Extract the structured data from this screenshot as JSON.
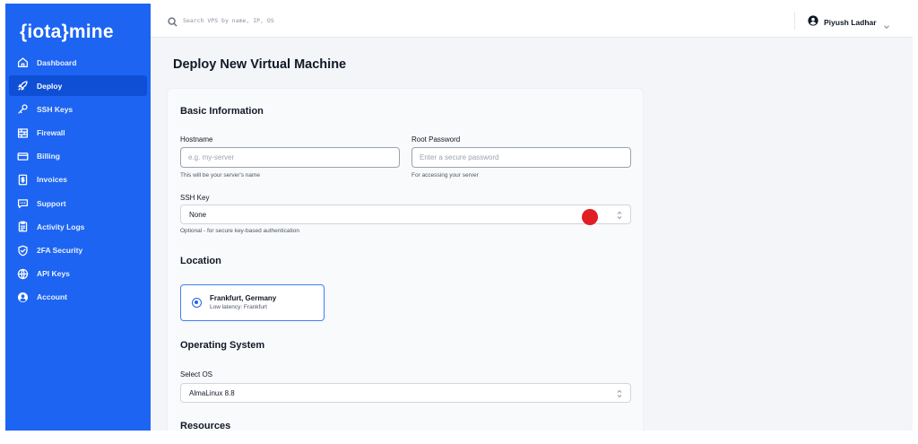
{
  "brand": "{iota}mine",
  "nav": [
    {
      "label": "Dashboard",
      "icon": "home-icon",
      "active": false
    },
    {
      "label": "Deploy",
      "icon": "rocket-icon",
      "active": true
    },
    {
      "label": "SSH Keys",
      "icon": "key-icon",
      "active": false
    },
    {
      "label": "Firewall",
      "icon": "firewall-icon",
      "active": false
    },
    {
      "label": "Billing",
      "icon": "credit-card-icon",
      "active": false
    },
    {
      "label": "Invoices",
      "icon": "invoice-icon",
      "active": false
    },
    {
      "label": "Support",
      "icon": "chat-icon",
      "active": false
    },
    {
      "label": "Activity Logs",
      "icon": "clipboard-icon",
      "active": false
    },
    {
      "label": "2FA Security",
      "icon": "shield-check-icon",
      "active": false
    },
    {
      "label": "API Keys",
      "icon": "globe-icon",
      "active": false
    },
    {
      "label": "Account",
      "icon": "user-circle-icon",
      "active": false
    }
  ],
  "topbar": {
    "search_placeholder": "Search VPS by name, IP, OS",
    "user_name": "Piyush Ladhar"
  },
  "page": {
    "title": "Deploy New Virtual Machine"
  },
  "form": {
    "basic_title": "Basic Information",
    "hostname_label": "Hostname",
    "hostname_placeholder": "e.g. my-server",
    "hostname_help": "This will be your server's name",
    "password_label": "Root Password",
    "password_placeholder": "Enter a secure password",
    "password_help": "For accessing your server",
    "ssh_label": "SSH Key",
    "ssh_value": "None",
    "ssh_help": "Optional - for secure key-based authentication",
    "location_title": "Location",
    "location_name": "Frankfurt, Germany",
    "location_sub": "Low latency: Frankfurt",
    "os_title": "Operating System",
    "os_label": "Select OS",
    "os_value": "AlmaLinux 8.8",
    "resources_title": "Resources"
  },
  "colors": {
    "sidebar": "#1d64f2",
    "sidebar_active": "#0f4fd6",
    "accent": "#2563eb",
    "marker": "#e11d26"
  }
}
